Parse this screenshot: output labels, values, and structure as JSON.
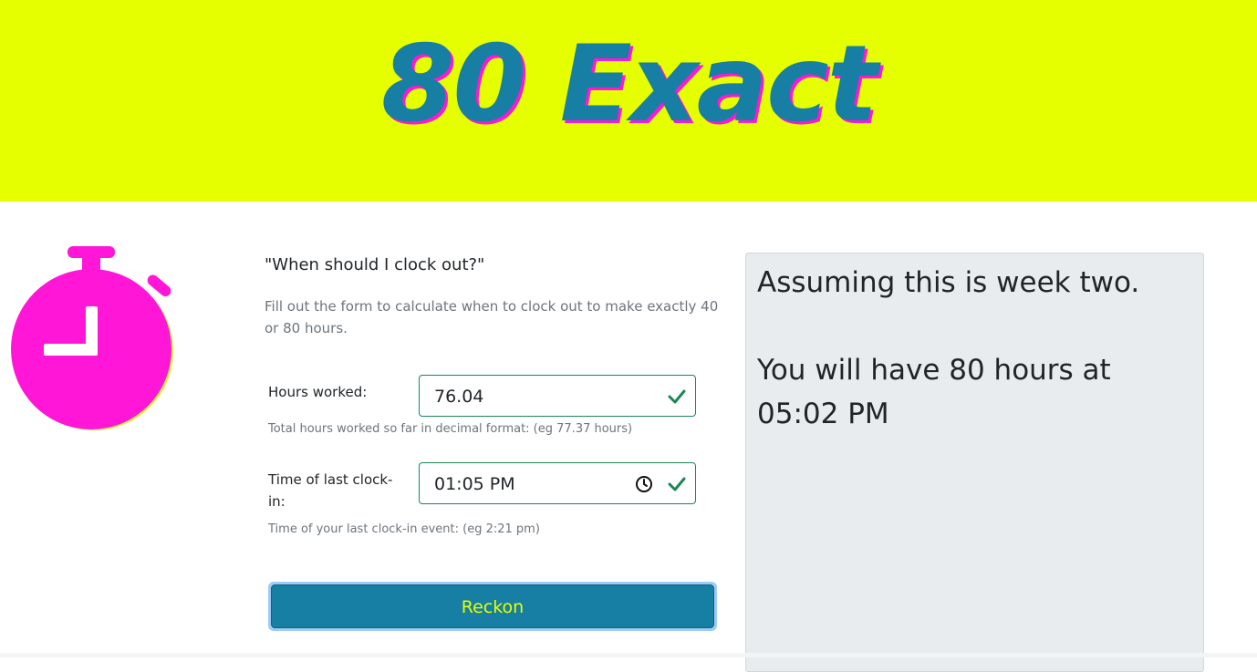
{
  "banner": {
    "title": "80 Exact",
    "background_color": "#e6ff00",
    "title_color": "#167fa3",
    "title_shadow_color": "#ff16d6"
  },
  "logo": {
    "icon": "stopwatch-icon",
    "color": "#ff16d6"
  },
  "form": {
    "question": "\"When should I clock out?\"",
    "lead": "Fill out the form to calculate when to clock out to make exactly 40 or 80 hours.",
    "hours_worked": {
      "label": "Hours worked:",
      "value": "76.04",
      "help": "Total hours worked so far in decimal format: (eg 77.37 hours)"
    },
    "last_clock_in": {
      "label": "Time of last clock-in:",
      "value": "01:05 PM",
      "help": "Time of your last clock-in event: (eg 2:21 pm)"
    },
    "submit_label": "Reckon"
  },
  "result": {
    "line1": "Assuming this is week two.",
    "line2": "You will have 80 hours at 05:02 PM"
  }
}
